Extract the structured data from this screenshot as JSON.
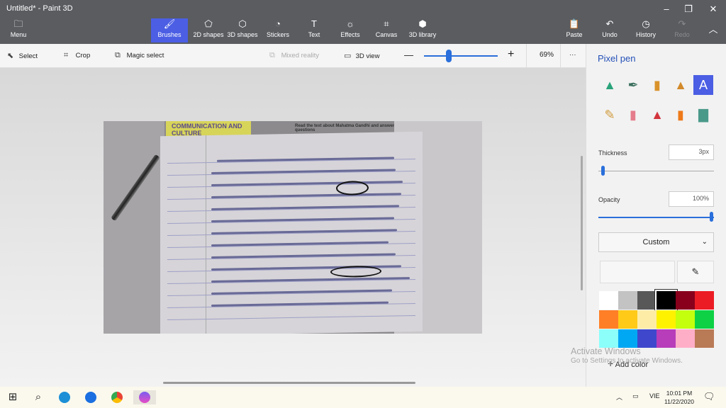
{
  "window": {
    "title": "Untitled* - Paint 3D",
    "minimize": "–",
    "restore": "❐",
    "close": "✕"
  },
  "ribbon": {
    "menu_label": "Menu",
    "tools": [
      {
        "label": "Brushes",
        "icon": "brush-icon"
      },
      {
        "label": "2D shapes",
        "icon": "shapes-2d-icon"
      },
      {
        "label": "3D shapes",
        "icon": "cube-icon"
      },
      {
        "label": "Stickers",
        "icon": "sticker-icon"
      },
      {
        "label": "Text",
        "icon": "text-icon"
      },
      {
        "label": "Effects",
        "icon": "sun-icon"
      },
      {
        "label": "Canvas",
        "icon": "canvas-icon"
      },
      {
        "label": "3D library",
        "icon": "library-icon"
      }
    ],
    "right": [
      {
        "label": "Paste",
        "icon": "paste-icon"
      },
      {
        "label": "Undo",
        "icon": "undo-icon"
      },
      {
        "label": "History",
        "icon": "history-icon"
      },
      {
        "label": "Redo",
        "icon": "redo-icon"
      }
    ]
  },
  "toolbar": {
    "select": "Select",
    "crop": "Crop",
    "magic_select": "Magic select",
    "mixed_reality": "Mixed reality",
    "view_3d": "3D view",
    "zoom_minus": "—",
    "zoom_plus": "+",
    "zoom_level": "69%",
    "more": "···"
  },
  "panel": {
    "title": "Pixel pen",
    "thickness_label": "Thickness",
    "thickness_value": "3px",
    "opacity_label": "Opacity",
    "opacity_value": "100%",
    "color_mode": "Custom",
    "add_color": "Add color",
    "palette": [
      "#ffffff",
      "#c3c3c3",
      "#585858",
      "#000000",
      "#88001b",
      "#ec1c24",
      "#ff7f27",
      "#ffca18",
      "#fdeca6",
      "#fff200",
      "#c4ff0e",
      "#0ed145",
      "#8cfffb",
      "#00a8f3",
      "#3f48cc",
      "#b83dba",
      "#ffaec8",
      "#b97a56"
    ],
    "brushes": [
      {
        "name": "marker",
        "glyph": "▲",
        "color": "#2aa37a"
      },
      {
        "name": "calligraphy-pen",
        "glyph": "✒",
        "color": "#3b6f5e"
      },
      {
        "name": "oil-brush",
        "glyph": "▮",
        "color": "#d9922a"
      },
      {
        "name": "watercolor",
        "glyph": "▲",
        "color": "#d28a2a"
      },
      {
        "name": "pixel-pen",
        "glyph": "A",
        "color": "#ffffff"
      },
      {
        "name": "pencil",
        "glyph": "✎",
        "color": "#d09a3a"
      },
      {
        "name": "eraser",
        "glyph": "▮",
        "color": "#e57c8c"
      },
      {
        "name": "crayon",
        "glyph": "▲",
        "color": "#d2343c"
      },
      {
        "name": "spray-can",
        "glyph": "▮",
        "color": "#ee7a1a"
      },
      {
        "name": "fill",
        "glyph": "▇",
        "color": "#4a9a8a"
      }
    ]
  },
  "canvas_image": {
    "book_heading": "COMMUNICATION AND CULTURE",
    "book_instruction": "Read the text about Mahatma Gandhi and answer the questions"
  },
  "watermark": {
    "line1": "Activate Windows",
    "line2": "Go to Settings to activate Windows."
  },
  "taskbar": {
    "time": "10:01 PM",
    "date": "11/22/2020",
    "lang": "VIE"
  }
}
